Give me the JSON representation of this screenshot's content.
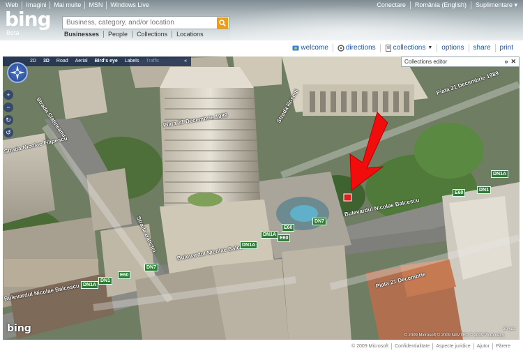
{
  "topnav": [
    "Web",
    "Imagini",
    "Mai multe",
    "MSN",
    "Windows Live"
  ],
  "topright": [
    "Conectare",
    "România (English)",
    "Suplimentare ▾"
  ],
  "logo": {
    "text": "bing",
    "tag": "Beta"
  },
  "search": {
    "placeholder": "Business, category, and/or location"
  },
  "scopes": [
    "Businesses",
    "People",
    "Collections",
    "Locations"
  ],
  "toolbar": {
    "welcome": "welcome",
    "directions": "directions",
    "collections": "collections",
    "options": "options",
    "share": "share",
    "print": "print"
  },
  "map_controls": {
    "mode_2d": "2D",
    "mode_3d": "3D",
    "road": "Road",
    "aerial": "Aerial",
    "birds_eye": "Bird's eye",
    "labels": "Labels",
    "traffic": "Traffic",
    "collapse": "«"
  },
  "collections_editor": {
    "title": "Collections editor",
    "min": "»",
    "close": "✕"
  },
  "map_labels": {
    "piata1": "Piata 21 Decembrie 1989",
    "piata2": "Piata 21 Decembrie 1989",
    "piata3": "Piata 21 Decembrie",
    "bulev1": "Bulevardul Nicolae Balcescu",
    "bulev2": "Bulevardul Nicolae Balcescu",
    "bulev3": "Bulevardul Nicolae Balcescu",
    "str_batistei": "Strada Batistei",
    "str_filipescu": "Strada Nicolae Filipescu",
    "str_slatineanu": "Strada Slatineanu",
    "str_rosetti": "Strada Rosetti"
  },
  "routes": [
    "DN1A",
    "E60",
    "DN1",
    "DN1A",
    "E60",
    "DN7",
    "DN1A",
    "E60",
    "DN7",
    "DN1A",
    "DN1",
    "E60"
  ],
  "watermark": "bing",
  "map_copyright": "© 2009 Microsoft   © 2009 NAVTEQ   © 2009 Pictometry",
  "scale": "30 yds",
  "footer": [
    "© 2009 Microsoft",
    "Confidentialitate",
    "Aspecte juridice",
    "Ajutor",
    "Părere"
  ]
}
